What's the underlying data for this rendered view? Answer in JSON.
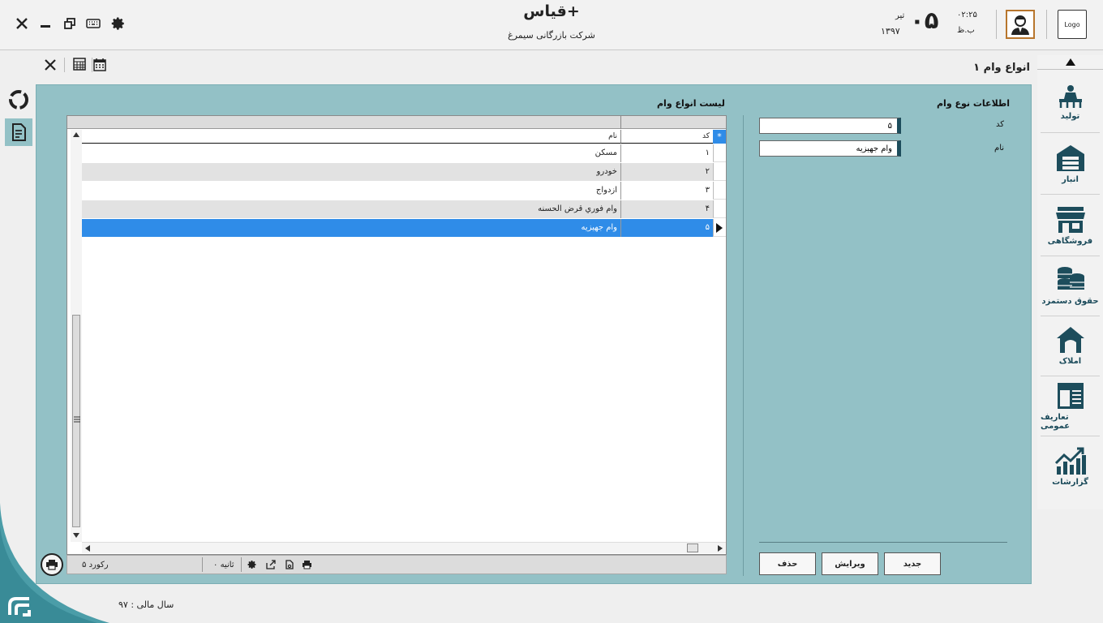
{
  "app": {
    "title": "قیاس+",
    "company": "شرکت بازرگانی سیمرغ",
    "logo_text": "Logo"
  },
  "datetime": {
    "day": "۰۵",
    "month": "تیر",
    "year": "۱۳۹۷",
    "time": "۰۲:۲۵",
    "ampm": "ب.ظ"
  },
  "page": {
    "title": "انواع وام ۱"
  },
  "nav": [
    {
      "label": "تولید",
      "icon": "production-icon"
    },
    {
      "label": "انبار",
      "icon": "warehouse-icon"
    },
    {
      "label": "فروشگاهی",
      "icon": "store-icon"
    },
    {
      "label": "حقوق دستمزد",
      "icon": "payroll-icon"
    },
    {
      "label": "املاک",
      "icon": "property-icon"
    },
    {
      "label": "تعاریف عمومی",
      "icon": "definitions-icon"
    },
    {
      "label": "گزارشات",
      "icon": "reports-icon"
    }
  ],
  "list": {
    "title": "لیست انواع وام",
    "columns": {
      "code": "کد",
      "name": "نام"
    },
    "new_row_marker": "*",
    "rows": [
      {
        "code": "۱",
        "name": "مسکن"
      },
      {
        "code": "۲",
        "name": "خودرو"
      },
      {
        "code": "۳",
        "name": "ازدواج"
      },
      {
        "code": "۴",
        "name": "وام فوري قرض الحسنه"
      },
      {
        "code": "۵",
        "name": "وام جهیزیه"
      }
    ],
    "selected_index": 4,
    "record_count": "۵ رکورد",
    "timer": "۰ ثانیه"
  },
  "form": {
    "title": "اطلاعات نوع وام",
    "code_label": "کد",
    "code_value": "۵",
    "name_label": "نام",
    "name_value": "وام جهیزیه"
  },
  "buttons": {
    "new": "جدید",
    "edit": "ویرایش",
    "delete": "حذف"
  },
  "footer": {
    "fiscal_year": "سال مالی : ۹۷"
  },
  "colors": {
    "panel": "#93c1c6",
    "selection": "#2f8ce8",
    "accent": "#1d4d5c"
  }
}
